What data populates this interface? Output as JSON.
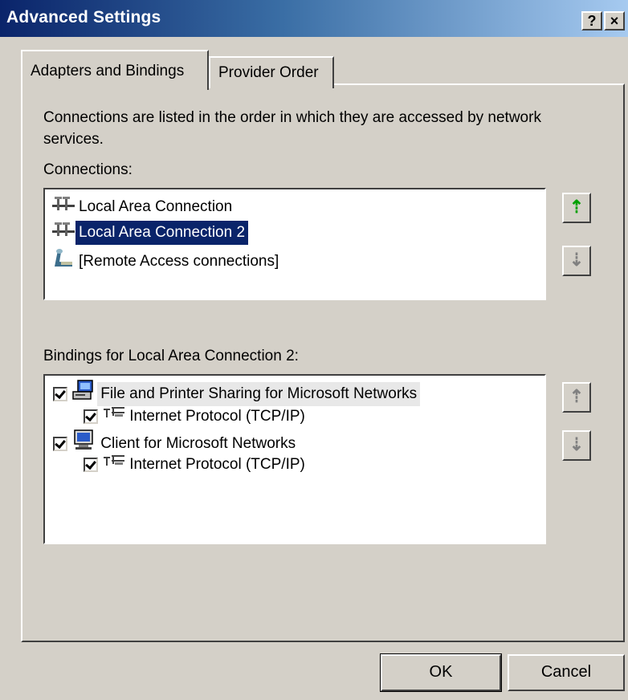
{
  "window": {
    "title": "Advanced Settings",
    "help_glyph": "?",
    "close_glyph": "×"
  },
  "tabs": [
    {
      "label": "Adapters and Bindings",
      "active": true
    },
    {
      "label": "Provider Order",
      "active": false
    }
  ],
  "description": "Connections are listed in the order in which they are accessed by network services.",
  "connections": {
    "label": "Connections:",
    "items": [
      {
        "label": "Local Area Connection",
        "icon": "lan-connection-icon",
        "selected": false
      },
      {
        "label": "Local Area Connection 2",
        "icon": "lan-connection-icon",
        "selected": true
      },
      {
        "label": "[Remote Access connections]",
        "icon": "remote-access-icon",
        "selected": false
      }
    ],
    "move_up_glyph": "⇡",
    "move_down_glyph": "⇣"
  },
  "bindings": {
    "label": "Bindings for Local Area Connection 2:",
    "items": [
      {
        "label": "File and Printer Sharing for Microsoft Networks",
        "level": 0,
        "checked": true,
        "icon": "file-printer-sharing-icon"
      },
      {
        "label": "Internet Protocol (TCP/IP)",
        "level": 1,
        "checked": true,
        "icon": "protocol-icon"
      },
      {
        "label": "Client for Microsoft Networks",
        "level": 0,
        "checked": true,
        "icon": "client-network-icon"
      },
      {
        "label": "Internet Protocol (TCP/IP)",
        "level": 1,
        "checked": true,
        "icon": "protocol-icon"
      }
    ],
    "move_up_glyph": "⇡",
    "move_down_glyph": "⇣"
  },
  "buttons": {
    "ok": "OK",
    "cancel": "Cancel"
  },
  "colors": {
    "selection": "#0a246a",
    "dialog_face": "#d4d0c8",
    "move_up_enabled": "#00a000"
  }
}
